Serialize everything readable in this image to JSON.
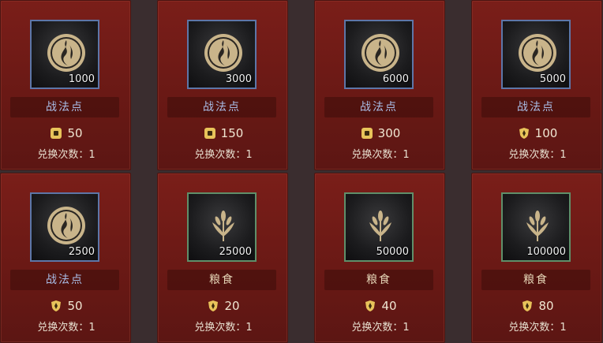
{
  "items": [
    {
      "name": "战法点",
      "qty": "1000",
      "icon": "tactic-point-icon",
      "frame": "blue",
      "currency": "coin-icon",
      "price": "50",
      "limit_label": "兑换次数：",
      "limit_value": "1"
    },
    {
      "name": "战法点",
      "qty": "3000",
      "icon": "tactic-point-icon",
      "frame": "blue",
      "currency": "coin-icon",
      "price": "150",
      "limit_label": "兑换次数：",
      "limit_value": "1"
    },
    {
      "name": "战法点",
      "qty": "6000",
      "icon": "tactic-point-icon",
      "frame": "blue",
      "currency": "coin-icon",
      "price": "300",
      "limit_label": "兑换次数：",
      "limit_value": "1"
    },
    {
      "name": "战法点",
      "qty": "5000",
      "icon": "tactic-point-icon",
      "frame": "blue",
      "currency": "shield-icon",
      "price": "100",
      "limit_label": "兑换次数：",
      "limit_value": "1"
    },
    {
      "name": "战法点",
      "qty": "2500",
      "icon": "tactic-point-icon",
      "frame": "blue",
      "currency": "shield-icon",
      "price": "50",
      "limit_label": "兑换次数：",
      "limit_value": "1"
    },
    {
      "name": "粮食",
      "qty": "25000",
      "icon": "grain-icon",
      "frame": "green",
      "currency": "shield-icon",
      "price": "20",
      "limit_label": "兑换次数：",
      "limit_value": "1"
    },
    {
      "name": "粮食",
      "qty": "50000",
      "icon": "grain-icon",
      "frame": "green",
      "currency": "shield-icon",
      "price": "40",
      "limit_label": "兑换次数：",
      "limit_value": "1"
    },
    {
      "name": "粮食",
      "qty": "100000",
      "icon": "grain-icon",
      "frame": "green",
      "currency": "shield-icon",
      "price": "80",
      "limit_label": "兑换次数：",
      "limit_value": "1"
    }
  ],
  "colors": {
    "card": "#6a1915",
    "blue_frame": "#5d76a8",
    "green_frame": "#5f8f6a",
    "gold": "#e8c35a"
  }
}
